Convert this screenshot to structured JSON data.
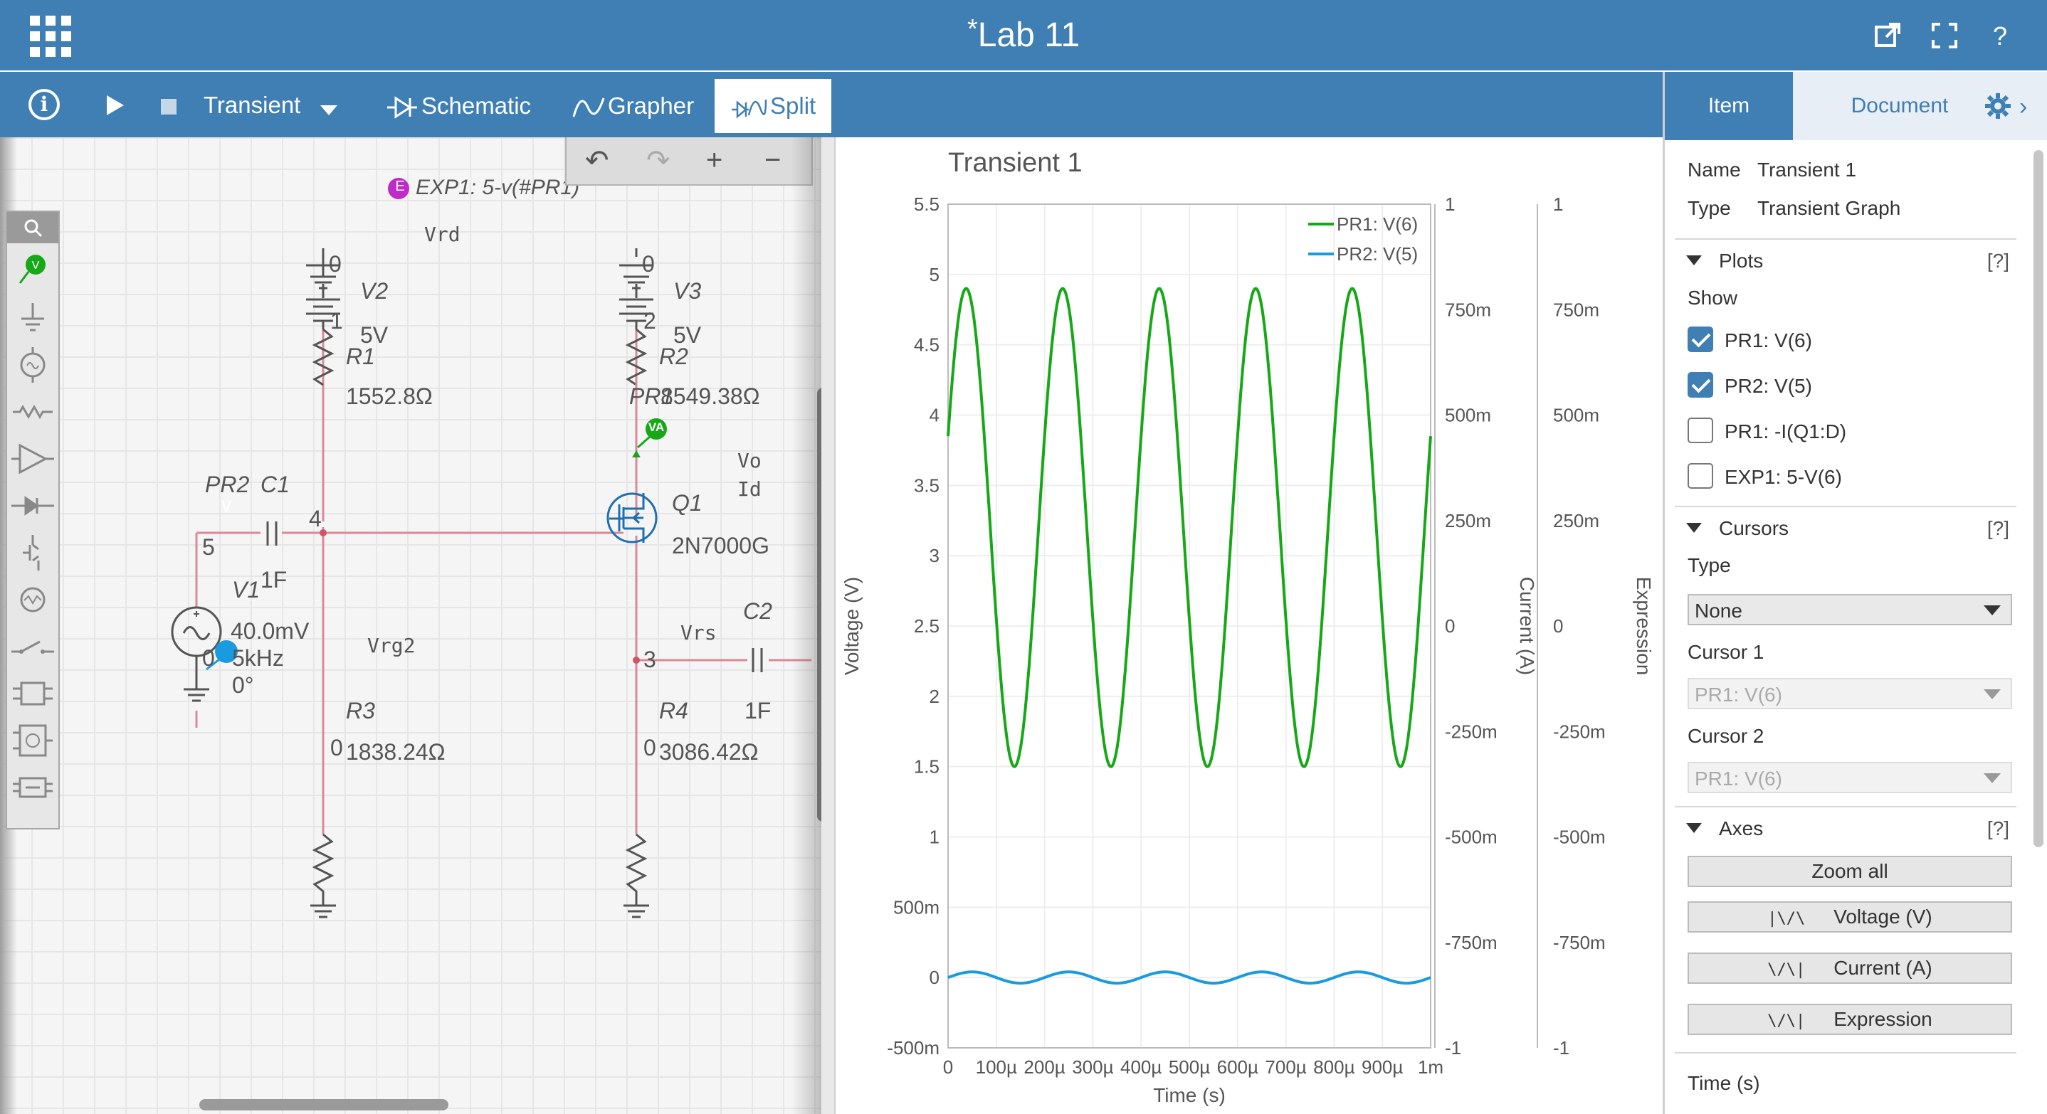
{
  "window": {
    "title": "Lab 11",
    "dirty_marker": "*"
  },
  "toolbar": {
    "info_label": "i",
    "analysis_mode": "Transient",
    "tabs": [
      {
        "label": "Schematic"
      },
      {
        "label": "Grapher"
      },
      {
        "label": "Split"
      }
    ]
  },
  "schematic": {
    "expression_probe": "EXP1: 5-v(#PR1)",
    "expression_badge": "E",
    "net_labels": [
      "Vrd",
      "Vo",
      "Id",
      "Vrg2",
      "Vrs"
    ],
    "components": {
      "V2": {
        "name": "V2",
        "value": "5V",
        "node_top": "0",
        "node_bottom": "1"
      },
      "V3": {
        "name": "V3",
        "value": "5V",
        "node_top": "0",
        "node_bottom": "2"
      },
      "R1": {
        "name": "R1",
        "value": "1552.8Ω"
      },
      "R2": {
        "name": "R2",
        "value": "8549.38Ω",
        "probe": "PR1"
      },
      "R3": {
        "name": "R3",
        "value": "1838.24Ω",
        "node": "0"
      },
      "R4": {
        "name": "R4",
        "value": "3086.42Ω",
        "node": "0"
      },
      "C1": {
        "name": "C1",
        "value": "1F"
      },
      "C2": {
        "name": "C2",
        "value": "1F"
      },
      "V1": {
        "name": "V1",
        "amplitude": "40.0mV",
        "frequency": "5kHz",
        "phase": "0°",
        "node": "0"
      },
      "Q1": {
        "name": "Q1",
        "model": "2N7000G"
      },
      "PR2": {
        "name": "PR2"
      }
    },
    "node_labels": {
      "n4": "4",
      "n5": "5",
      "n3": "3"
    },
    "probe_badges": {
      "voltage": "V",
      "va": "VA"
    },
    "colors": {
      "wire": "#d98a96",
      "component": "#555555",
      "node_dot": "#cc5566"
    }
  },
  "graph": {
    "title": "Transient 1",
    "legend": [
      {
        "label": "PR1: V(6)",
        "color": "#17a817"
      },
      {
        "label": "PR2: V(5)",
        "color": "#1a9be0"
      }
    ],
    "y_left_label": "Voltage (V)",
    "y_left_ticks": [
      "5.5",
      "5",
      "4.5",
      "4",
      "3.5",
      "3",
      "2.5",
      "2",
      "1.5",
      "1",
      "500m",
      "0",
      "-500m"
    ],
    "y_mid_label": "Current (A)",
    "y_mid_ticks": [
      "1",
      "750m",
      "500m",
      "250m",
      "0",
      "-250m",
      "-500m",
      "-750m",
      "-1"
    ],
    "y_right_label": "Expression",
    "y_right_ticks": [
      "1",
      "750m",
      "500m",
      "250m",
      "0",
      "-250m",
      "-500m",
      "-750m",
      "-1"
    ],
    "x_label": "Time (s)",
    "x_ticks": [
      "0",
      "100µ",
      "200µ",
      "300µ",
      "400µ",
      "500µ",
      "600µ",
      "700µ",
      "800µ",
      "900µ",
      "1m"
    ]
  },
  "chart_data": {
    "type": "line",
    "title": "Transient 1",
    "xlabel": "Time (s)",
    "ylabel": "Voltage (V)",
    "xlim": [
      0,
      0.001
    ],
    "ylim": [
      -0.5,
      5.5
    ],
    "grid": true,
    "legend_position": "top-right",
    "series": [
      {
        "name": "PR1: V(6)",
        "waveform": "sine",
        "frequency_hz": 5000,
        "offset_v": 3.2,
        "amplitude_v": 1.7,
        "start_v": 3.85
      },
      {
        "name": "PR2: V(5)",
        "waveform": "sine",
        "frequency_hz": 5000,
        "offset_v": 0.0,
        "amplitude_v": 0.04,
        "start_v": 0.0
      }
    ]
  },
  "panel": {
    "tabs": [
      {
        "label": "Item"
      },
      {
        "label": "Document"
      }
    ],
    "name_label": "Name",
    "name_value": "Transient 1",
    "type_label": "Type",
    "type_value": "Transient Graph",
    "plots": {
      "title": "Plots",
      "help": "[?]",
      "show_label": "Show",
      "items": [
        {
          "label": "PR1: V(6)",
          "checked": true
        },
        {
          "label": "PR2: V(5)",
          "checked": true
        },
        {
          "label": "PR1: -I(Q1:D)",
          "checked": false
        },
        {
          "label": "EXP1: 5-V(6)",
          "checked": false
        }
      ]
    },
    "cursors": {
      "title": "Cursors",
      "help": "[?]",
      "type_label": "Type",
      "type_value": "None",
      "cursor1_label": "Cursor 1",
      "cursor1_value": "PR1: V(6)",
      "cursor2_label": "Cursor 2",
      "cursor2_value": "PR1: V(6)"
    },
    "axes": {
      "title": "Axes",
      "help": "[?]",
      "zoom_all": "Zoom all",
      "voltage": "Voltage (V)",
      "current": "Current (A)",
      "expression": "Expression",
      "voltage_icon": "|\\/\\",
      "current_icon": "\\/\\|",
      "expression_icon": "\\/\\|"
    },
    "time_label": "Time (s)"
  }
}
